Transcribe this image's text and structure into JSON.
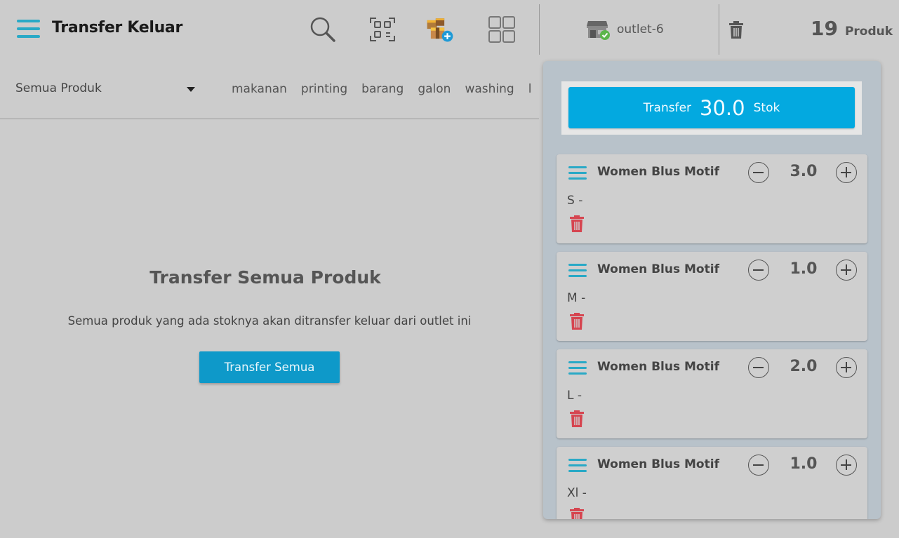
{
  "header": {
    "title": "Transfer Keluar",
    "outlet": "outlet-6",
    "product_count": "19",
    "product_unit": "Produk"
  },
  "icons": {
    "menu": "hamburger-menu-icon",
    "search": "search-icon",
    "scan": "barcode-scan-icon",
    "add_product": "add-box-icon",
    "grid": "grid-view-icon",
    "outlet": "store-check-icon",
    "trash": "trash-icon"
  },
  "categories": {
    "selected": "Semua Produk",
    "tabs": [
      "makanan",
      "printing",
      "barang",
      "galon",
      "washing",
      "la"
    ]
  },
  "empty_state": {
    "title": "Transfer Semua Produk",
    "description": "Semua produk yang ada stoknya akan ditransfer keluar dari outlet ini",
    "button_label": "Transfer Semua"
  },
  "transfer": {
    "prefix": "Transfer",
    "amount": "30.0",
    "suffix": "Stok"
  },
  "items": [
    {
      "name": "Women Blus Motif",
      "qty": "3.0",
      "variant": "S -"
    },
    {
      "name": "Women Blus Motif",
      "qty": "1.0",
      "variant": "M -"
    },
    {
      "name": "Women Blus Motif",
      "qty": "2.0",
      "variant": "L -"
    },
    {
      "name": "Women Blus Motif",
      "qty": "1.0",
      "variant": "Xl -"
    }
  ],
  "colors": {
    "accent": "#03a9e0",
    "button_dark": "#0e99c9",
    "menu_icon": "#29a9c6",
    "delete": "#d64550",
    "panel_bg": "#b8c2ca"
  }
}
